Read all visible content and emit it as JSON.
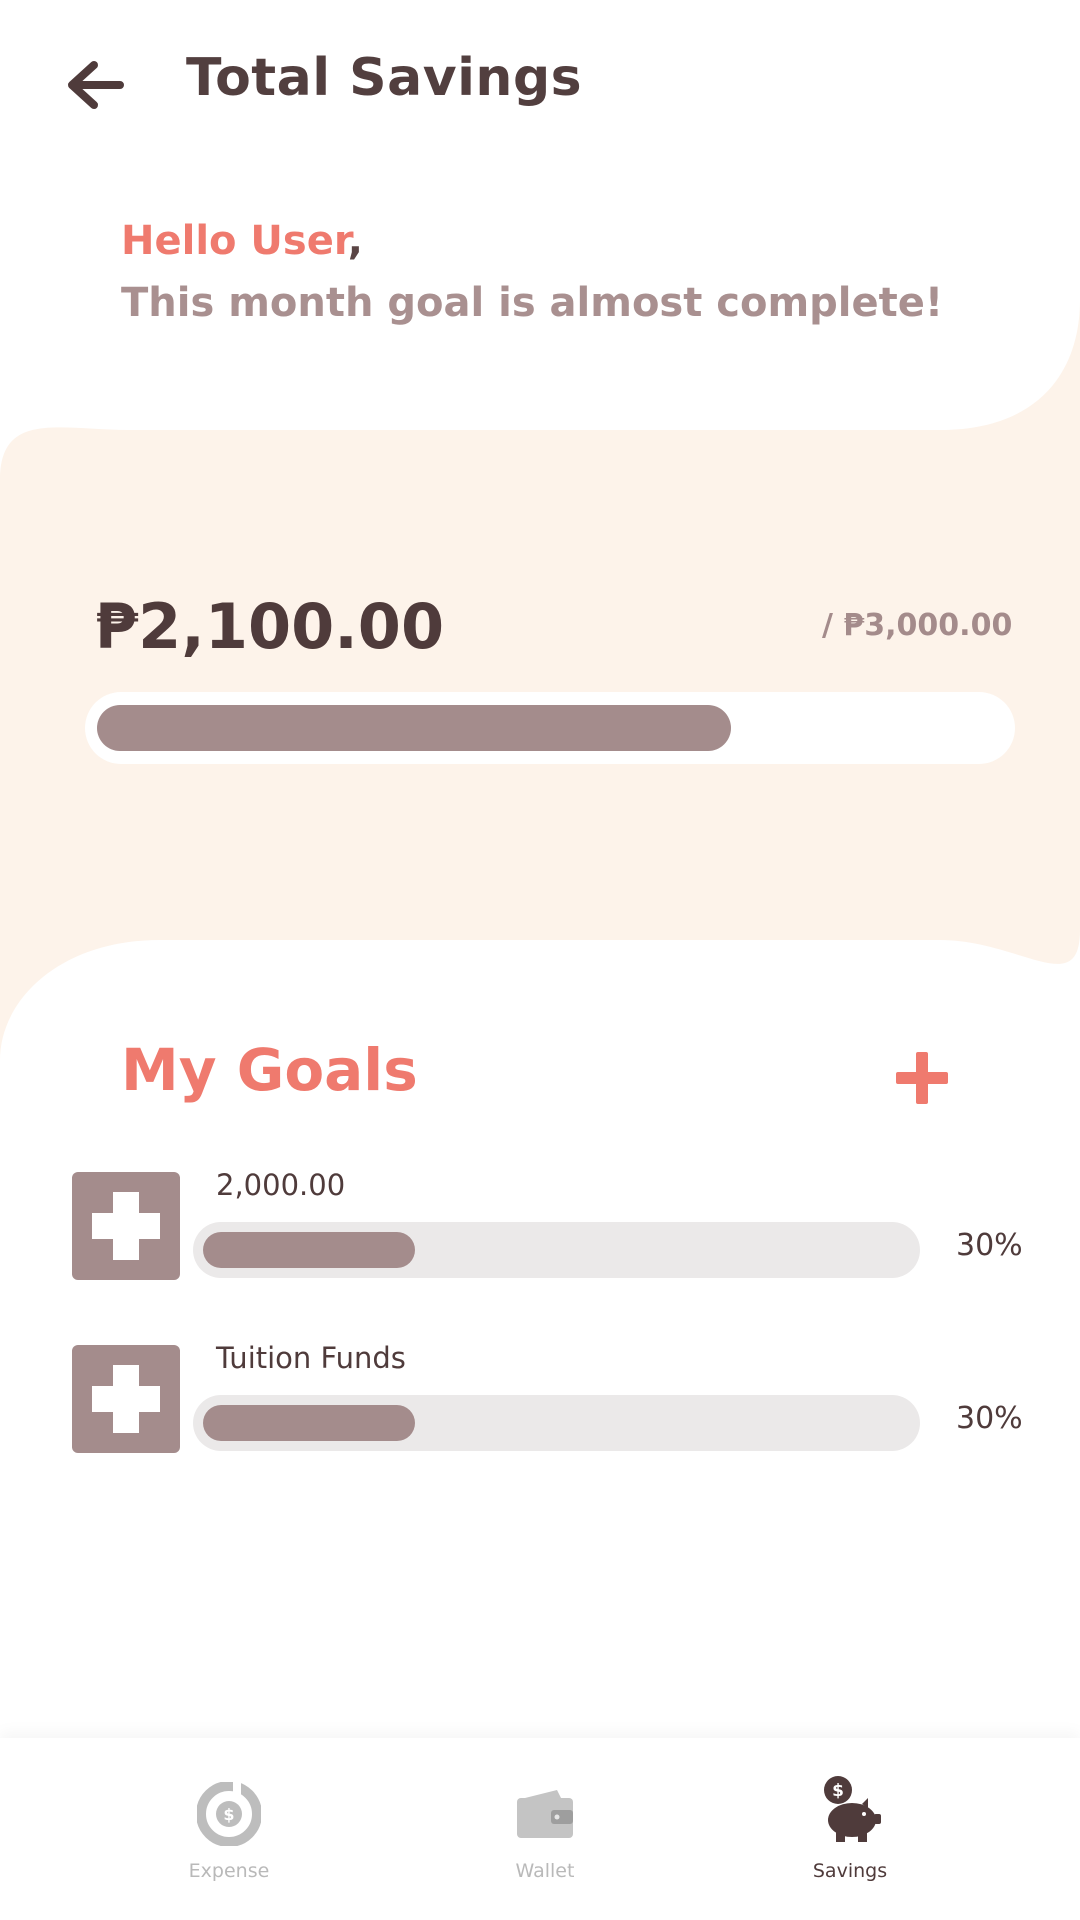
{
  "header": {
    "title": "Total Savings"
  },
  "greeting": {
    "hello": "Hello User",
    "comma": ",",
    "message": "This month goal is almost complete!"
  },
  "summary": {
    "saved": "₱2,100.00",
    "target": "/ ₱3,000.00",
    "progress_fraction": 0.7
  },
  "goals": {
    "title": "My Goals",
    "items": [
      {
        "name": "2,000.00",
        "percent": "30%",
        "progress_fraction": 0.3
      },
      {
        "name": "Tuition Funds",
        "percent": "30%",
        "progress_fraction": 0.3
      }
    ]
  },
  "nav": {
    "items": [
      {
        "label": "Expense",
        "icon": "expense-icon",
        "active": false
      },
      {
        "label": "Wallet",
        "icon": "wallet-icon",
        "active": false
      },
      {
        "label": "Savings",
        "icon": "piggy-bank-icon",
        "active": true
      }
    ]
  },
  "colors": {
    "accent": "#ef7a6e",
    "primary_text": "#523f3f",
    "progress": "#a48c8c",
    "card_bg": "#fdf3ea"
  }
}
